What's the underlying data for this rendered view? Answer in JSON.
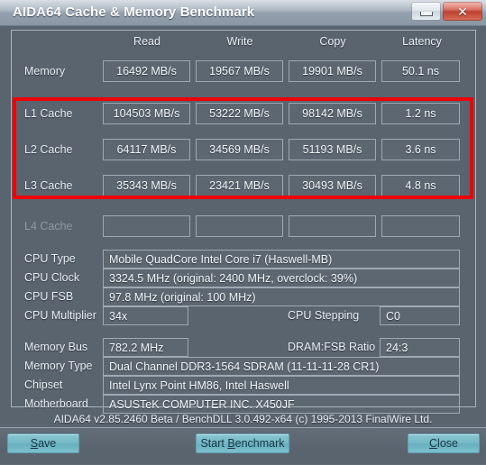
{
  "window": {
    "title": "AIDA64 Cache & Memory Benchmark",
    "minimize_label": "Minimize",
    "close_label": "✕"
  },
  "benchmark": {
    "columns": [
      "Read",
      "Write",
      "Copy",
      "Latency"
    ],
    "rows": [
      {
        "label": "Memory",
        "read": "16492 MB/s",
        "write": "19567 MB/s",
        "copy": "19901 MB/s",
        "latency": "50.1 ns",
        "enabled": true
      },
      {
        "label": "L1 Cache",
        "read": "104503 MB/s",
        "write": "53222 MB/s",
        "copy": "98142 MB/s",
        "latency": "1.2 ns",
        "enabled": true
      },
      {
        "label": "L2 Cache",
        "read": "64117 MB/s",
        "write": "34569 MB/s",
        "copy": "51193 MB/s",
        "latency": "3.6 ns",
        "enabled": true
      },
      {
        "label": "L3 Cache",
        "read": "35343 MB/s",
        "write": "23421 MB/s",
        "copy": "30493 MB/s",
        "latency": "4.8 ns",
        "enabled": true
      },
      {
        "label": "L4 Cache",
        "read": "",
        "write": "",
        "copy": "",
        "latency": "",
        "enabled": false
      }
    ],
    "highlight_color": "#ee0000"
  },
  "system": {
    "cpu_type_label": "CPU Type",
    "cpu_type_value": "Mobile QuadCore Intel Core i7  (Haswell-MB)",
    "cpu_clock_label": "CPU Clock",
    "cpu_clock_value": "3324.5 MHz  (original: 2400 MHz, overclock: 39%)",
    "cpu_fsb_label": "CPU FSB",
    "cpu_fsb_value": "97.8 MHz  (original: 100 MHz)",
    "cpu_multiplier_label": "CPU Multiplier",
    "cpu_multiplier_value": "34x",
    "cpu_stepping_label": "CPU Stepping",
    "cpu_stepping_value": "C0",
    "memory_bus_label": "Memory Bus",
    "memory_bus_value": "782.2 MHz",
    "dram_fsb_ratio_label": "DRAM:FSB Ratio",
    "dram_fsb_ratio_value": "24:3",
    "memory_type_label": "Memory Type",
    "memory_type_value": "Dual Channel DDR3-1564 SDRAM  (11-11-11-28 CR1)",
    "chipset_label": "Chipset",
    "chipset_value": "Intel Lynx Point HM86, Intel Haswell",
    "motherboard_label": "Motherboard",
    "motherboard_value": "ASUSTeK COMPUTER INC. X450JF"
  },
  "footer": {
    "version_text": "AIDA64 v2.85.2460 Beta / BenchDLL 3.0.492-x64  (c) 1995-2013 FinalWire Ltd.",
    "save_label": "Save",
    "save_accel": "S",
    "save_rest": "ave",
    "start_label": "Start Benchmark",
    "start_pre": "Start ",
    "start_accel": "B",
    "start_rest": "enchmark",
    "close_label": "Close",
    "close_accel": "C",
    "close_rest": "lose"
  }
}
